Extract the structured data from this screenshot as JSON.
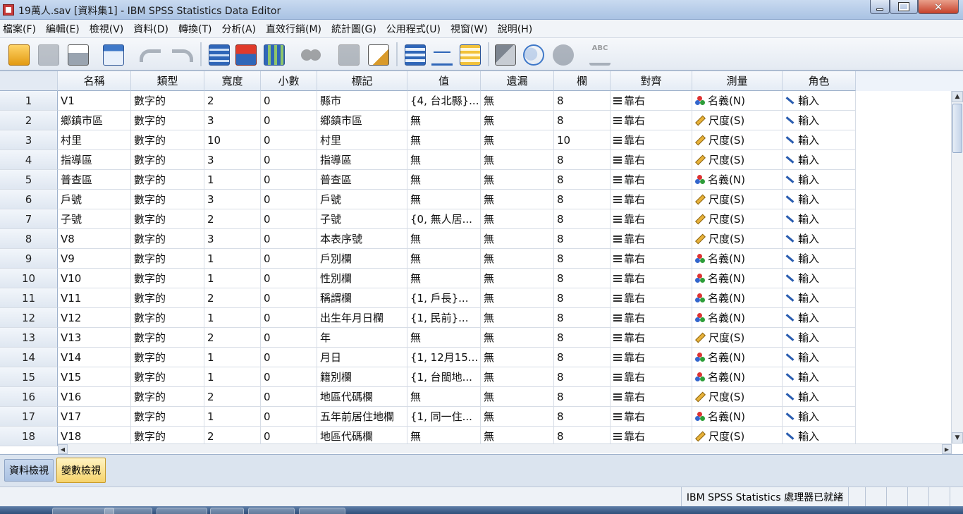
{
  "window": {
    "title": "19萬人.sav [資料集1] - IBM SPSS Statistics Data Editor",
    "controls": [
      "minimize",
      "maximize",
      "close"
    ]
  },
  "menu": [
    "檔案(F)",
    "編輯(E)",
    "檢視(V)",
    "資料(D)",
    "轉換(T)",
    "分析(A)",
    "直效行銷(M)",
    "統計圖(G)",
    "公用程式(U)",
    "視窗(W)",
    "說明(H)"
  ],
  "toolbar": [
    "open-file-icon",
    "save-icon",
    "print-icon",
    "recall-dialog-icon",
    "undo-icon",
    "redo-icon",
    "go-to-case-icon",
    "go-to-variable-icon",
    "variables-icon",
    "find-icon",
    "insert-cases-icon",
    "insert-variable-icon",
    "split-file-icon",
    "weight-cases-icon",
    "select-cases-icon",
    "value-labels-icon",
    "use-sets-icon",
    "show-all-variables-icon",
    "spell-check-icon"
  ],
  "columns": [
    "名稱",
    "類型",
    "寬度",
    "小數",
    "標記",
    "值",
    "遺漏",
    "欄",
    "對齊",
    "測量",
    "角色"
  ],
  "rows": [
    {
      "num": "1",
      "name": "V1",
      "type": "數字的",
      "width": "2",
      "decimals": "0",
      "label": "縣市",
      "values": "{4, 台北縣}...",
      "missing": "無",
      "columns": "8",
      "align": "靠右",
      "measure": "名義(N)",
      "measure_kind": "nominal",
      "role": "輸入"
    },
    {
      "num": "2",
      "name": "鄉鎮市區",
      "type": "數字的",
      "width": "3",
      "decimals": "0",
      "label": "鄉鎮市區",
      "values": "無",
      "missing": "無",
      "columns": "8",
      "align": "靠右",
      "measure": "尺度(S)",
      "measure_kind": "scale",
      "role": "輸入"
    },
    {
      "num": "3",
      "name": "村里",
      "type": "數字的",
      "width": "10",
      "decimals": "0",
      "label": "村里",
      "values": "無",
      "missing": "無",
      "columns": "10",
      "align": "靠右",
      "measure": "尺度(S)",
      "measure_kind": "scale",
      "role": "輸入"
    },
    {
      "num": "4",
      "name": "指導區",
      "type": "數字的",
      "width": "3",
      "decimals": "0",
      "label": "指導區",
      "values": "無",
      "missing": "無",
      "columns": "8",
      "align": "靠右",
      "measure": "尺度(S)",
      "measure_kind": "scale",
      "role": "輸入"
    },
    {
      "num": "5",
      "name": "普查區",
      "type": "數字的",
      "width": "1",
      "decimals": "0",
      "label": "普查區",
      "values": "無",
      "missing": "無",
      "columns": "8",
      "align": "靠右",
      "measure": "名義(N)",
      "measure_kind": "nominal",
      "role": "輸入"
    },
    {
      "num": "6",
      "name": "戶號",
      "type": "數字的",
      "width": "3",
      "decimals": "0",
      "label": "戶號",
      "values": "無",
      "missing": "無",
      "columns": "8",
      "align": "靠右",
      "measure": "尺度(S)",
      "measure_kind": "scale",
      "role": "輸入"
    },
    {
      "num": "7",
      "name": "子號",
      "type": "數字的",
      "width": "2",
      "decimals": "0",
      "label": "子號",
      "values": "{0, 無人居...",
      "missing": "無",
      "columns": "8",
      "align": "靠右",
      "measure": "尺度(S)",
      "measure_kind": "scale",
      "role": "輸入"
    },
    {
      "num": "8",
      "name": "V8",
      "type": "數字的",
      "width": "3",
      "decimals": "0",
      "label": "本表序號",
      "values": "無",
      "missing": "無",
      "columns": "8",
      "align": "靠右",
      "measure": "尺度(S)",
      "measure_kind": "scale",
      "role": "輸入"
    },
    {
      "num": "9",
      "name": "V9",
      "type": "數字的",
      "width": "1",
      "decimals": "0",
      "label": "戶別欄",
      "values": "無",
      "missing": "無",
      "columns": "8",
      "align": "靠右",
      "measure": "名義(N)",
      "measure_kind": "nominal",
      "role": "輸入"
    },
    {
      "num": "10",
      "name": "V10",
      "type": "數字的",
      "width": "1",
      "decimals": "0",
      "label": "性別欄",
      "values": "無",
      "missing": "無",
      "columns": "8",
      "align": "靠右",
      "measure": "名義(N)",
      "measure_kind": "nominal",
      "role": "輸入"
    },
    {
      "num": "11",
      "name": "V11",
      "type": "數字的",
      "width": "2",
      "decimals": "0",
      "label": "稱謂欄",
      "values": "{1, 戶長}...",
      "missing": "無",
      "columns": "8",
      "align": "靠右",
      "measure": "名義(N)",
      "measure_kind": "nominal",
      "role": "輸入"
    },
    {
      "num": "12",
      "name": "V12",
      "type": "數字的",
      "width": "1",
      "decimals": "0",
      "label": "出生年月日欄",
      "values": "{1, 民前}...",
      "missing": "無",
      "columns": "8",
      "align": "靠右",
      "measure": "名義(N)",
      "measure_kind": "nominal",
      "role": "輸入"
    },
    {
      "num": "13",
      "name": "V13",
      "type": "數字的",
      "width": "2",
      "decimals": "0",
      "label": "年",
      "values": "無",
      "missing": "無",
      "columns": "8",
      "align": "靠右",
      "measure": "尺度(S)",
      "measure_kind": "scale",
      "role": "輸入"
    },
    {
      "num": "14",
      "name": "V14",
      "type": "數字的",
      "width": "1",
      "decimals": "0",
      "label": "月日",
      "values": "{1, 12月15...",
      "missing": "無",
      "columns": "8",
      "align": "靠右",
      "measure": "名義(N)",
      "measure_kind": "nominal",
      "role": "輸入"
    },
    {
      "num": "15",
      "name": "V15",
      "type": "數字的",
      "width": "1",
      "decimals": "0",
      "label": "籍別欄",
      "values": "{1, 台閩地...",
      "missing": "無",
      "columns": "8",
      "align": "靠右",
      "measure": "名義(N)",
      "measure_kind": "nominal",
      "role": "輸入"
    },
    {
      "num": "16",
      "name": "V16",
      "type": "數字的",
      "width": "2",
      "decimals": "0",
      "label": "地區代碼欄",
      "values": "無",
      "missing": "無",
      "columns": "8",
      "align": "靠右",
      "measure": "尺度(S)",
      "measure_kind": "scale",
      "role": "輸入"
    },
    {
      "num": "17",
      "name": "V17",
      "type": "數字的",
      "width": "1",
      "decimals": "0",
      "label": "五年前居住地欄",
      "values": "{1, 同一住...",
      "missing": "無",
      "columns": "8",
      "align": "靠右",
      "measure": "名義(N)",
      "measure_kind": "nominal",
      "role": "輸入"
    },
    {
      "num": "18",
      "name": "V18",
      "type": "數字的",
      "width": "2",
      "decimals": "0",
      "label": "地區代碼欄",
      "values": "無",
      "missing": "無",
      "columns": "8",
      "align": "靠右",
      "measure": "尺度(S)",
      "measure_kind": "scale",
      "role": "輸入"
    }
  ],
  "tabs": {
    "data_view": "資料檢視",
    "variable_view": "變數檢視",
    "active": "variable_view"
  },
  "status": {
    "text": "IBM SPSS Statistics 處理器已就緒"
  },
  "colors": {
    "active_tab": "#f6d36b",
    "title_bar": "#a9c2e3",
    "close_button": "#c6402a"
  }
}
